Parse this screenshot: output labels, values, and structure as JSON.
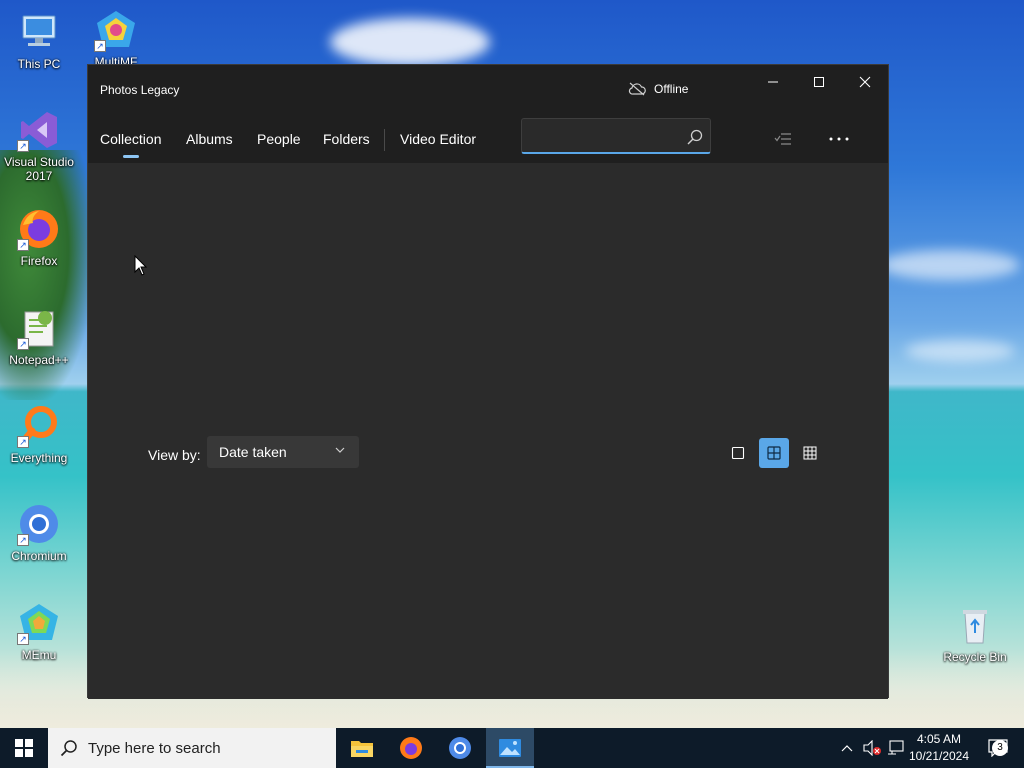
{
  "desktop": {
    "icons": [
      {
        "label": "This PC",
        "icon": "computer-icon"
      },
      {
        "label": "MultiMF",
        "icon": "multimf-icon"
      },
      {
        "label": "Visual Studio 2017",
        "icon": "visual-studio-icon"
      },
      {
        "label": "Firefox",
        "icon": "firefox-icon"
      },
      {
        "label": "Notepad++",
        "icon": "notepadpp-icon"
      },
      {
        "label": "Everything",
        "icon": "everything-search-icon"
      },
      {
        "label": "Chromium",
        "icon": "chromium-icon"
      },
      {
        "label": "MEmu",
        "icon": "memu-icon"
      },
      {
        "label": "Recycle Bin",
        "icon": "recycle-bin-icon"
      }
    ]
  },
  "window": {
    "title": "Photos Legacy",
    "status": "Offline",
    "controls": {
      "minimize": "minimize-icon",
      "maximize": "maximize-icon",
      "close": "close-icon"
    },
    "nav": {
      "tabs": [
        {
          "label": "Collection",
          "active": true
        },
        {
          "label": "Albums",
          "active": false
        },
        {
          "label": "People",
          "active": false
        },
        {
          "label": "Folders",
          "active": false
        },
        {
          "label": "Video Editor",
          "active": false
        }
      ],
      "search": {
        "value": "",
        "placeholder": ""
      },
      "select_icon": "select-list-icon",
      "more_icon": "more-options-icon"
    },
    "content": {
      "view_by_label": "View by:",
      "view_by_value": "Date taken",
      "view_modes": [
        {
          "name": "large-tiles-icon",
          "selected": false
        },
        {
          "name": "medium-tiles-icon",
          "selected": true
        },
        {
          "name": "small-tiles-icon",
          "selected": false
        }
      ]
    }
  },
  "taskbar": {
    "search_placeholder": "Type here to search",
    "apps": [
      "file-explorer-icon",
      "firefox-icon",
      "chromium-icon",
      "photos-icon"
    ],
    "time": "4:05 AM",
    "date": "10/21/2024",
    "notification_count": "3",
    "accent": "#0d1b29"
  },
  "colors": {
    "window_bg": "#2b2b2b",
    "titlebar_bg": "#1f1f1f",
    "accent": "#5aa7e8"
  }
}
